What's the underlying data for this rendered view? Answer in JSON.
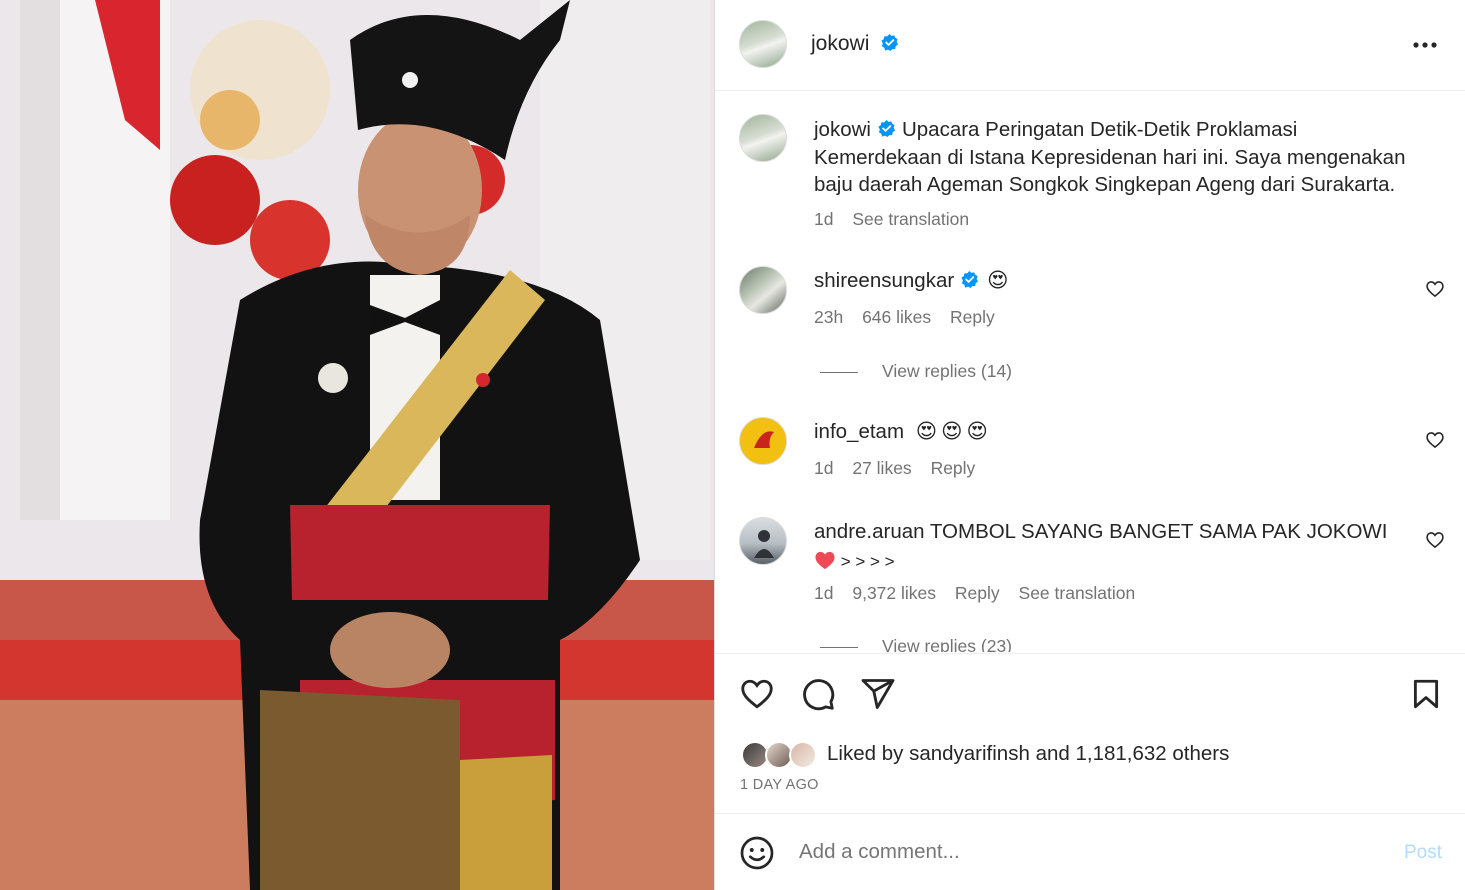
{
  "header": {
    "username": "jokowi",
    "more_icon": "more-horizontal-icon"
  },
  "caption": {
    "username": "jokowi",
    "text": "Upacara Peringatan Detik-Detik Proklamasi Kemerdekaan di Istana Kepresidenan hari ini. Saya mengenakan baju daerah Ageman Songkok Singkepan Ageng dari Surakarta.",
    "line1": "Upacara Peringatan Detik-Detik Proklamasi",
    "line2": "Kemerdekaan di Istana Kepresidenan hari ini. Saya mengenakan",
    "line3": "baju daerah Ageman Songkok Singkepan Ageng dari Surakarta.",
    "time": "1d",
    "see_translation": "See translation"
  },
  "comments": [
    {
      "username": "shireensungkar",
      "text": "😍",
      "time": "23h",
      "likes": "646 likes",
      "reply": "Reply",
      "view_replies": "View replies (14)"
    },
    {
      "username": "info_etam",
      "text": "😍😍😍",
      "time": "1d",
      "likes": "27 likes",
      "reply": "Reply"
    },
    {
      "username": "andre.aruan",
      "text_line1": "TOMBOL SAYANG BANGET SAMA PAK JOKOWI",
      "text_line2": " > > > >",
      "time": "1d",
      "likes": "9,372 likes",
      "reply": "Reply",
      "see_translation": "See translation",
      "view_replies": "View replies (23)"
    }
  ],
  "actions": {
    "liked_by_prefix": "Liked by",
    "liked_by_user": "sandyarifinsh",
    "liked_by_and": "and",
    "liked_by_count": "1,181,632 others",
    "date": "1 DAY AGO"
  },
  "comment_input": {
    "placeholder": "Add a comment...",
    "post_label": "Post"
  },
  "colors": {
    "verified": "#0095f6",
    "post_disabled": "#b3dbff",
    "secondary_text": "#737373",
    "heart_red": "#ed4956"
  }
}
